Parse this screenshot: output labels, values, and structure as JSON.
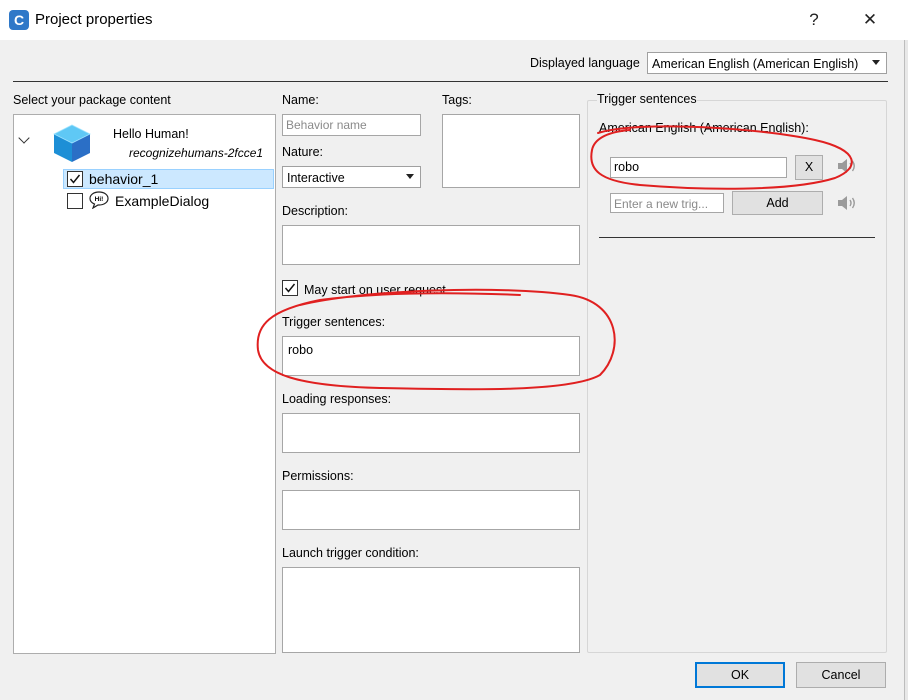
{
  "window": {
    "title": "Project properties",
    "app_icon_letter": "C",
    "help_glyph": "?",
    "close_glyph": "✕"
  },
  "language": {
    "label": "Displayed language",
    "selected": "American English (American English)"
  },
  "package": {
    "section_label": "Select your package content",
    "root_name": "Hello Human!",
    "root_id": "recognizehumans-2fcce1",
    "items": [
      {
        "label": "behavior_1",
        "checked": true,
        "selected": true
      },
      {
        "label": "ExampleDialog",
        "checked": false,
        "selected": false
      }
    ],
    "dialog_icon_text": "Hi!"
  },
  "form": {
    "name_label": "Name:",
    "name_placeholder": "Behavior name",
    "tags_label": "Tags:",
    "nature_label": "Nature:",
    "nature_value": "Interactive",
    "description_label": "Description:",
    "user_request_label": "May start on user request",
    "user_request_checked": true,
    "trigger_label": "Trigger sentences:",
    "trigger_value": "robo",
    "loading_label": "Loading responses:",
    "permissions_label": "Permissions:",
    "launch_label": "Launch trigger condition:"
  },
  "trigger_panel": {
    "title": "Trigger sentences",
    "language_label": "American English (American English):",
    "sentence": "robo",
    "remove_label": "X",
    "new_placeholder": "Enter a new trig...",
    "add_label": "Add",
    "speaker_icon": "speaker-icon"
  },
  "buttons": {
    "ok": "OK",
    "cancel": "Cancel"
  },
  "colors": {
    "selection_bg": "#cce8ff",
    "annotation": "#e02020",
    "ok_border": "#0078d7"
  }
}
